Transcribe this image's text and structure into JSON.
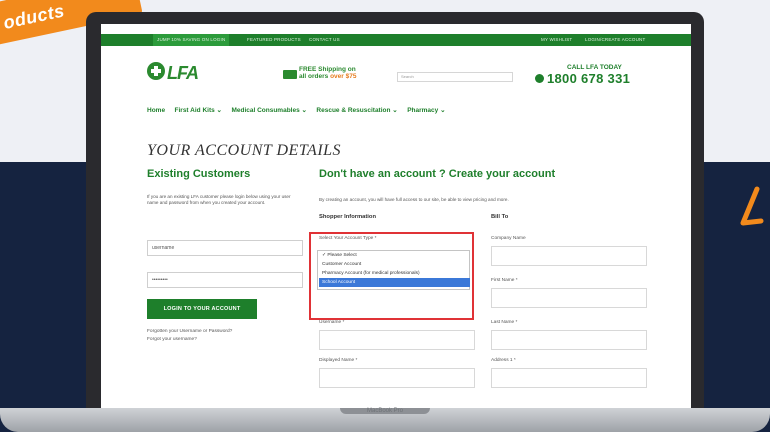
{
  "promo": {
    "ribbon_text": "oducts"
  },
  "topbar": {
    "items": [
      "JUMP 10% SAVING ON LOGIN",
      "FEATURED PRODUCTS",
      "CONTACT US"
    ],
    "right": [
      "MY WISHLIST",
      "LOGIN/CREATE ACCOUNT"
    ]
  },
  "brand": {
    "logo_text": "LFA",
    "accent": "#1e7f2b",
    "orange": "#e67b1d"
  },
  "shipping": {
    "line1": "FREE Shipping on",
    "line2_prefix": "all orders",
    "line2_highlight": "over $75"
  },
  "search": {
    "placeholder": "Search"
  },
  "call": {
    "label": "CALL LFA TODAY",
    "phone": "1800 678 331"
  },
  "nav": [
    "Home",
    "First Aid Kits ⌄",
    "Medical Consumables ⌄",
    "Rescue & Resuscitation ⌄",
    "Pharmacy ⌄"
  ],
  "page_title": "YOUR ACCOUNT DETAILS",
  "existing": {
    "heading": "Existing Customers",
    "intro": "If you are an existing LFA customer please login below using your user name and password from when you created your account.",
    "username_value": "username",
    "password_value": "•••••••••",
    "login_button": "LOGIN TO YOUR ACCOUNT",
    "forgot_password": "Forgotten your Username or Password?",
    "forgot_username": "Forgot your username?"
  },
  "create": {
    "heading": "Don't have an account ? Create your account",
    "intro": "By creating an account, you will have full access to our site, be able to view pricing and more.",
    "shopper_heading": "Shopper Information",
    "billto_heading": "Bill To",
    "account_type_label": "Select Your Account Type *",
    "account_type_options": [
      "✓ Please Select",
      "Customer Account",
      "Pharmacy Account (for medical professionals)",
      "School Account"
    ],
    "account_type_selected": "School Account",
    "username_label": "Username *",
    "display_name_label": "Displayed Name *",
    "company_label": "Company Name",
    "first_name_label": "First Name *",
    "last_name_label": "Last Name *",
    "address_label": "Address 1 *"
  },
  "device": {
    "label": "MacBook Pro"
  }
}
